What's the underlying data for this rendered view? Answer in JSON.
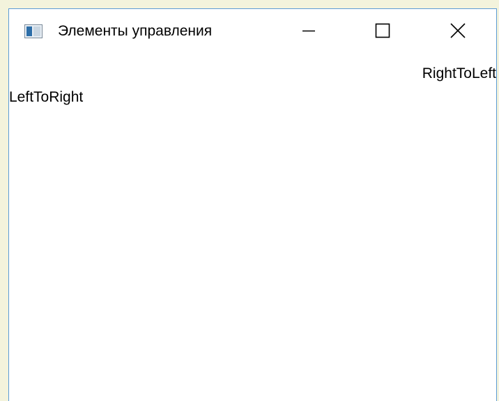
{
  "window": {
    "title": "Элементы управления",
    "icon": "window-app-icon",
    "controls": {
      "minimize_icon": "minimize-icon",
      "maximize_icon": "maximize-icon",
      "close_icon": "close-icon"
    }
  },
  "content": {
    "right_to_left_label": "RightToLeft",
    "left_to_right_label": "LeftToRight"
  },
  "colors": {
    "desktop_background": "#f3f3dc",
    "window_border": "#5b9bd5",
    "window_background": "#ffffff"
  }
}
